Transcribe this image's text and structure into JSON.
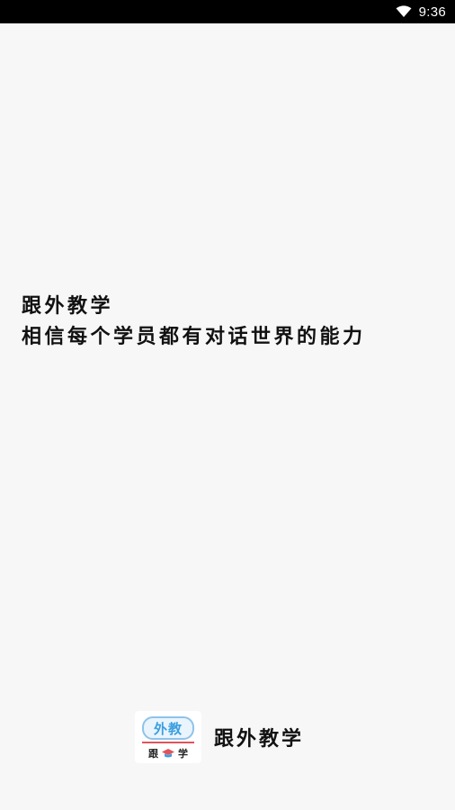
{
  "status_bar": {
    "time": "9:36",
    "icons": [
      "wifi-icon"
    ]
  },
  "splash": {
    "slogan_title": "跟外教学",
    "slogan_text": "相信每个学员都有对话世界的能力",
    "brand": {
      "name": "跟外教学",
      "logo_top_text": "外教",
      "logo_bottom_left": "跟",
      "logo_bottom_right": "学",
      "logo_icon": "graduation-cap-icon"
    }
  },
  "colors": {
    "background": "#f7f7f7",
    "status_bar": "#000000",
    "text": "#111111",
    "logo_blue": "#3a9ee0",
    "logo_red": "#e0545b"
  }
}
